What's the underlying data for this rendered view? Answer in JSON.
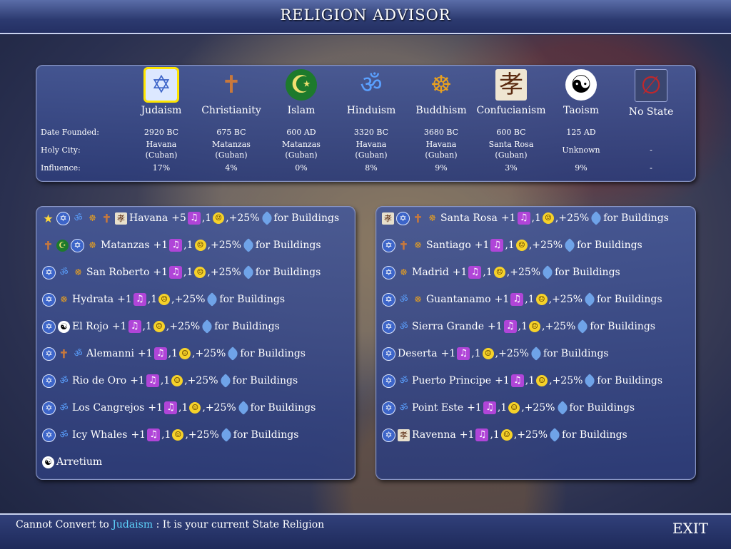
{
  "title": "RELIGION ADVISOR",
  "row_labels": {
    "founded": "Date Founded:",
    "holy_city": "Holy City:",
    "influence": "Influence:"
  },
  "religions": [
    {
      "name": "Judaism",
      "icon": "star-of-david-icon",
      "glyph": "✡",
      "founded": "2920 BC",
      "holy1": "Havana",
      "holy2": "(Cuban)",
      "holy": "",
      "influence": "17%",
      "color": "#3c64c8",
      "selected": true
    },
    {
      "name": "Christianity",
      "icon": "cross-icon",
      "glyph": "✝",
      "founded": "675 BC",
      "holy1": "Matanzas",
      "holy2": "(Guban)",
      "holy": "",
      "influence": "4%",
      "color": "#c8783c"
    },
    {
      "name": "Islam",
      "icon": "crescent-icon",
      "glyph": "☪",
      "founded": "600 AD",
      "holy1": "Matanzas",
      "holy2": "(Guban)",
      "holy": "",
      "influence": "0%",
      "color": "#1d7a2c"
    },
    {
      "name": "Hinduism",
      "icon": "om-icon",
      "glyph": "ॐ",
      "founded": "3320 BC",
      "holy1": "Havana",
      "holy2": "(Guban)",
      "holy": "",
      "influence": "8%",
      "color": "#5aa0ff"
    },
    {
      "name": "Buddhism",
      "icon": "buddha-icon",
      "glyph": "☸",
      "founded": "3680 BC",
      "holy1": "Havana",
      "holy2": "(Guban)",
      "holy": "",
      "influence": "9%",
      "color": "#e8a020"
    },
    {
      "name": "Confucianism",
      "icon": "confucian-icon",
      "glyph": "孝",
      "founded": "600 BC",
      "holy1": "Santa Rosa",
      "holy2": "(Guban)",
      "holy": "",
      "influence": "3%",
      "color": "#5a2a10"
    },
    {
      "name": "Taoism",
      "icon": "yin-yang-icon",
      "glyph": "☯",
      "founded": "125 AD",
      "holy1": "",
      "holy2": "",
      "holy": "Unknown",
      "influence": "9%",
      "color": "#000000"
    },
    {
      "name": "No State",
      "icon": "no-state-icon",
      "glyph": "∅",
      "founded": "",
      "holy1": "",
      "holy2": "",
      "holy": "-",
      "influence": "-",
      "color": "#c0282c"
    }
  ],
  "left_cities": [
    {
      "name": "Havana",
      "icons": [
        "star",
        "jud",
        "hin",
        "bud",
        "chr",
        "con"
      ],
      "bonus": "+5",
      "happy": "1",
      "research": "+25%",
      "suffix": "for Buildings"
    },
    {
      "name": "Matanzas",
      "icons": [
        "chr",
        "isl",
        "jud",
        "bud"
      ],
      "bonus": "+1",
      "happy": "1",
      "research": "+25%",
      "suffix": "for Buildings"
    },
    {
      "name": "San Roberto",
      "icons": [
        "jud",
        "hin",
        "bud"
      ],
      "bonus": "+1",
      "happy": "1",
      "research": "+25%",
      "suffix": "for Buildings"
    },
    {
      "name": "Hydrata",
      "icons": [
        "jud",
        "bud"
      ],
      "bonus": "+1",
      "happy": "1",
      "research": "+25%",
      "suffix": "for Buildings"
    },
    {
      "name": "El Rojo",
      "icons": [
        "jud",
        "tao"
      ],
      "bonus": "+1",
      "happy": "1",
      "research": "+25%",
      "suffix": "for Buildings"
    },
    {
      "name": "Alemanni",
      "icons": [
        "jud",
        "chr",
        "hin"
      ],
      "bonus": "+1",
      "happy": "1",
      "research": "+25%",
      "suffix": "for Buildings"
    },
    {
      "name": "Rio de Oro",
      "icons": [
        "jud",
        "hin"
      ],
      "bonus": "+1",
      "happy": "1",
      "research": "+25%",
      "suffix": "for Buildings"
    },
    {
      "name": "Los Cangrejos",
      "icons": [
        "jud",
        "hin"
      ],
      "bonus": "+1",
      "happy": "1",
      "research": "+25%",
      "suffix": "for Buildings"
    },
    {
      "name": "Icy Whales",
      "icons": [
        "jud",
        "hin"
      ],
      "bonus": "+1",
      "happy": "1",
      "research": "+25%",
      "suffix": "for Buildings"
    },
    {
      "name": "Arretium",
      "icons": [
        "tao"
      ],
      "bonus": "",
      "happy": "",
      "research": "",
      "suffix": ""
    }
  ],
  "right_cities": [
    {
      "name": "Santa Rosa",
      "icons": [
        "con",
        "jud",
        "chr",
        "bud"
      ],
      "bonus": "+1",
      "happy": "1",
      "research": "+25%",
      "suffix": "for Buildings"
    },
    {
      "name": "Santiago",
      "icons": [
        "jud",
        "chr",
        "bud"
      ],
      "bonus": "+1",
      "happy": "1",
      "research": "+25%",
      "suffix": "for Buildings"
    },
    {
      "name": "Madrid",
      "icons": [
        "jud",
        "bud"
      ],
      "bonus": "+1",
      "happy": "1",
      "research": "+25%",
      "suffix": "for Buildings"
    },
    {
      "name": "Guantanamo",
      "icons": [
        "jud",
        "hin",
        "bud"
      ],
      "bonus": "+1",
      "happy": "1",
      "research": "+25%",
      "suffix": "for Buildings"
    },
    {
      "name": "Sierra Grande",
      "icons": [
        "jud",
        "hin"
      ],
      "bonus": "+1",
      "happy": "1",
      "research": "+25%",
      "suffix": "for Buildings"
    },
    {
      "name": "Deserta",
      "icons": [
        "jud"
      ],
      "bonus": "+1",
      "happy": "1",
      "research": "+25%",
      "suffix": "for Buildings"
    },
    {
      "name": "Puerto Principe",
      "icons": [
        "jud",
        "hin"
      ],
      "bonus": "+1",
      "happy": "1",
      "research": "+25%",
      "suffix": "for Buildings"
    },
    {
      "name": "Point Este",
      "icons": [
        "jud",
        "hin"
      ],
      "bonus": "+1",
      "happy": "1",
      "research": "+25%",
      "suffix": "for Buildings"
    },
    {
      "name": "Ravenna",
      "icons": [
        "jud",
        "con"
      ],
      "bonus": "+1",
      "happy": "1",
      "research": "+25%",
      "suffix": "for Buildings"
    }
  ],
  "status": {
    "prefix": "Cannot Convert to",
    "religion": "Judaism",
    "suffix": ": It is your current State Religion"
  },
  "exit_label": "EXIT"
}
